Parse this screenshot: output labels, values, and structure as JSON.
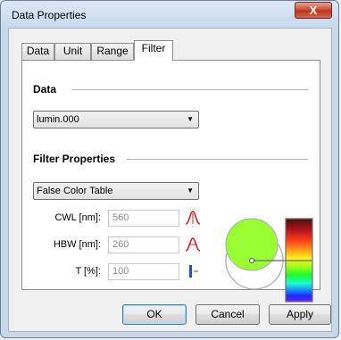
{
  "window": {
    "title": "Data Properties",
    "close_glyph": "X"
  },
  "tabs": [
    {
      "label": "Data",
      "active": false
    },
    {
      "label": "Unit",
      "active": false
    },
    {
      "label": "Range",
      "active": false
    },
    {
      "label": "Filter",
      "active": true
    }
  ],
  "data_group": {
    "title": "Data",
    "combo_value": "lumin.000"
  },
  "filter_group": {
    "title": "Filter Properties",
    "combo_value": "False Color Table",
    "fields": [
      {
        "label": "CWL [nm]:",
        "value": "560",
        "icon": "gaussian-center-icon"
      },
      {
        "label": "HBW [nm]:",
        "value": "260",
        "icon": "gaussian-width-icon"
      },
      {
        "label": "T [%]:",
        "value": "100",
        "icon": "transmission-icon"
      }
    ]
  },
  "colors": {
    "selected_color": "#99ff33",
    "gaussian_icon": "#d42020",
    "transmission_icon": "#2a4bd0"
  },
  "buttons": {
    "ok": "OK",
    "cancel": "Cancel",
    "apply": "Apply"
  }
}
